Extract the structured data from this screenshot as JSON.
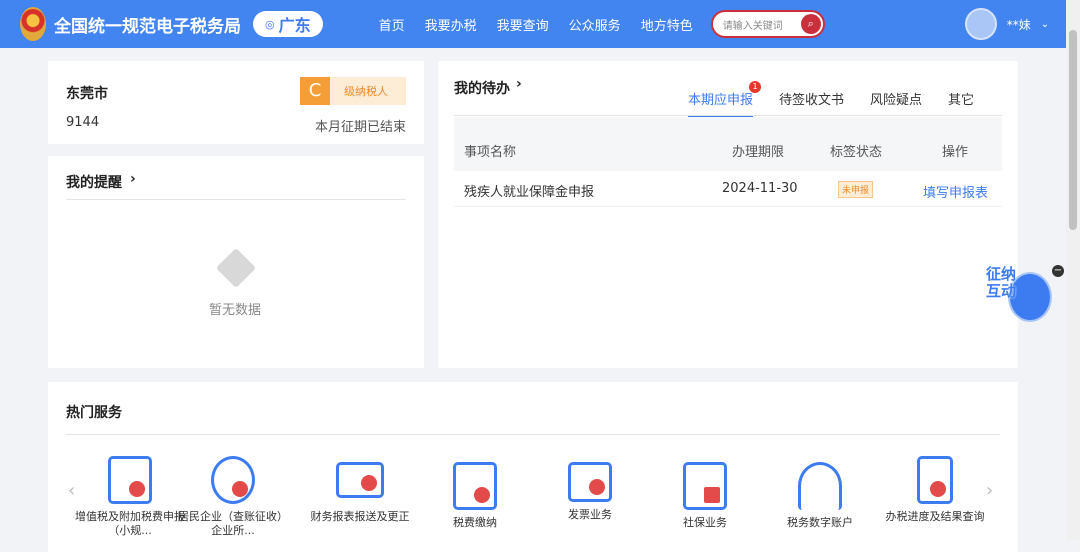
{
  "header": {
    "title": "全国统一规范电子税务局",
    "region": "广东",
    "nav": [
      "首页",
      "我要办税",
      "我要查询",
      "公众服务",
      "地方特色"
    ],
    "search_placeholder": "请输入关键词",
    "user": "**妹"
  },
  "taxpayer": {
    "city": "东莞市",
    "id": "9144",
    "grade": "C",
    "grade_label": "级纳税人",
    "period_status": "本月征期已结束"
  },
  "reminder": {
    "title": "我的提醒",
    "empty": "暂无数据"
  },
  "todo": {
    "title": "我的待办",
    "tabs": [
      {
        "label": "本期应申报",
        "badge": "1"
      },
      {
        "label": "待签收文书"
      },
      {
        "label": "风险疑点"
      },
      {
        "label": "其它"
      }
    ],
    "columns": [
      "事项名称",
      "办理期限",
      "标签状态",
      "操作"
    ],
    "rows": [
      {
        "name": "残疾人就业保障金申报",
        "deadline": "2024-11-30",
        "status": "未申报",
        "action": "填写申报表"
      }
    ]
  },
  "float": {
    "text": "征纳互动"
  },
  "services": {
    "title": "热门服务",
    "items": [
      "增值税及附加税费申报（小规...",
      "居民企业（查账征收）企业所...",
      "财务报表报送及更正",
      "税费缴纳",
      "发票业务",
      "社保业务",
      "税务数字账户",
      "办税进度及结果查询"
    ]
  },
  "colors": {
    "brand": "#4284f0",
    "danger": "#c9303b",
    "warning": "#f59d37"
  }
}
